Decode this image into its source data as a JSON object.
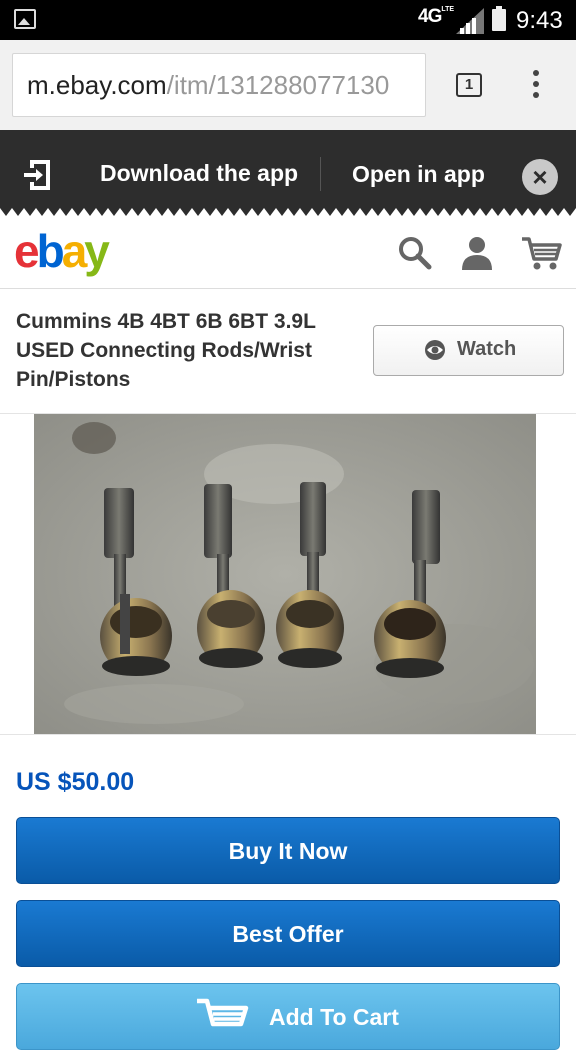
{
  "status_bar": {
    "network": "4G",
    "network_sub": "LTE",
    "time": "9:43"
  },
  "browser": {
    "url_host": "m.ebay.com",
    "url_path": "/itm/131288077130",
    "tab_count": "1"
  },
  "app_banner": {
    "download_label": "Download the app",
    "open_label": "Open in app",
    "close_glyph": "×"
  },
  "header": {
    "logo": {
      "e": "e",
      "b": "b",
      "a": "a",
      "y": "y"
    },
    "icons": [
      "search-icon",
      "account-icon",
      "cart-icon"
    ]
  },
  "item": {
    "title": "Cummins 4B 4BT 6B 6BT 3.9L USED Connecting Rods/Wrist Pin/Pistons",
    "watch_label": "Watch",
    "price": "US $50.00"
  },
  "actions": {
    "buy_now": "Buy It Now",
    "best_offer": "Best Offer",
    "add_to_cart": "Add To Cart"
  },
  "colors": {
    "ebay_red": "#e53238",
    "ebay_blue": "#0064d2",
    "ebay_yellow": "#f5af02",
    "ebay_green": "#86b817",
    "price_blue": "#0654ba",
    "primary_button": "#0a5ba8",
    "cart_button": "#4aa8dc",
    "banner_bg": "#2d2d2d"
  }
}
